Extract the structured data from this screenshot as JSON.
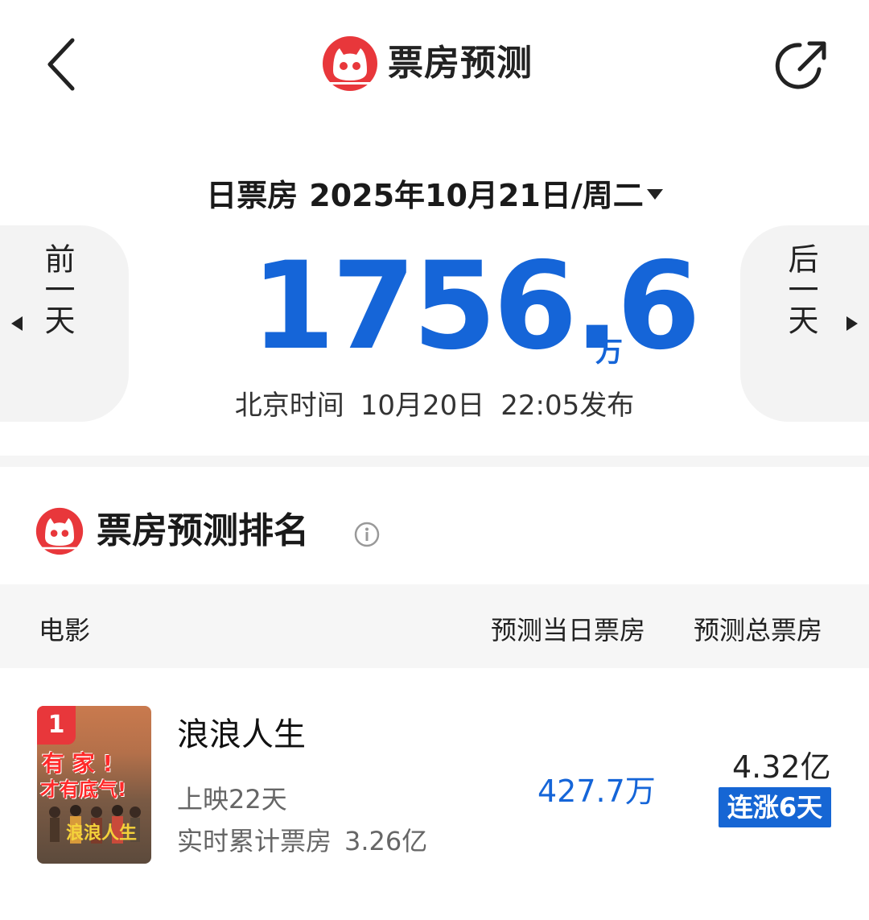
{
  "header": {
    "title": "票房预测",
    "back_icon": "chevron-left-icon",
    "share_icon": "share-icon",
    "logo_icon": "maoyan-cat-logo"
  },
  "date_selector": {
    "label": "日票房",
    "date": "2025年10月21日/周二"
  },
  "nav": {
    "prev_label": "前一天",
    "next_label": "后一天"
  },
  "summary": {
    "value": "1756.6",
    "unit": "万",
    "publish_prefix": "北京时间",
    "publish_date": "10月20日",
    "publish_time": "22:05发布"
  },
  "ranking": {
    "title": "票房预测排名",
    "columns": {
      "movie": "电影",
      "today": "预测当日票房",
      "total": "预测总票房"
    },
    "rows": [
      {
        "rank": "1",
        "poster_text_1": "有 家 !",
        "poster_text_2": "才有底气!",
        "poster_logo": "浪浪人生",
        "title": "浪浪人生",
        "days": "上映22天",
        "cum_label": "实时累计票房",
        "cum_value": "3.26亿",
        "today": "427.7万",
        "total": "4.32亿",
        "streak": "连涨6天"
      }
    ]
  },
  "colors": {
    "accent_blue": "#1565d8",
    "brand_red": "#e8373b",
    "badge_blue": "#1666d4"
  }
}
